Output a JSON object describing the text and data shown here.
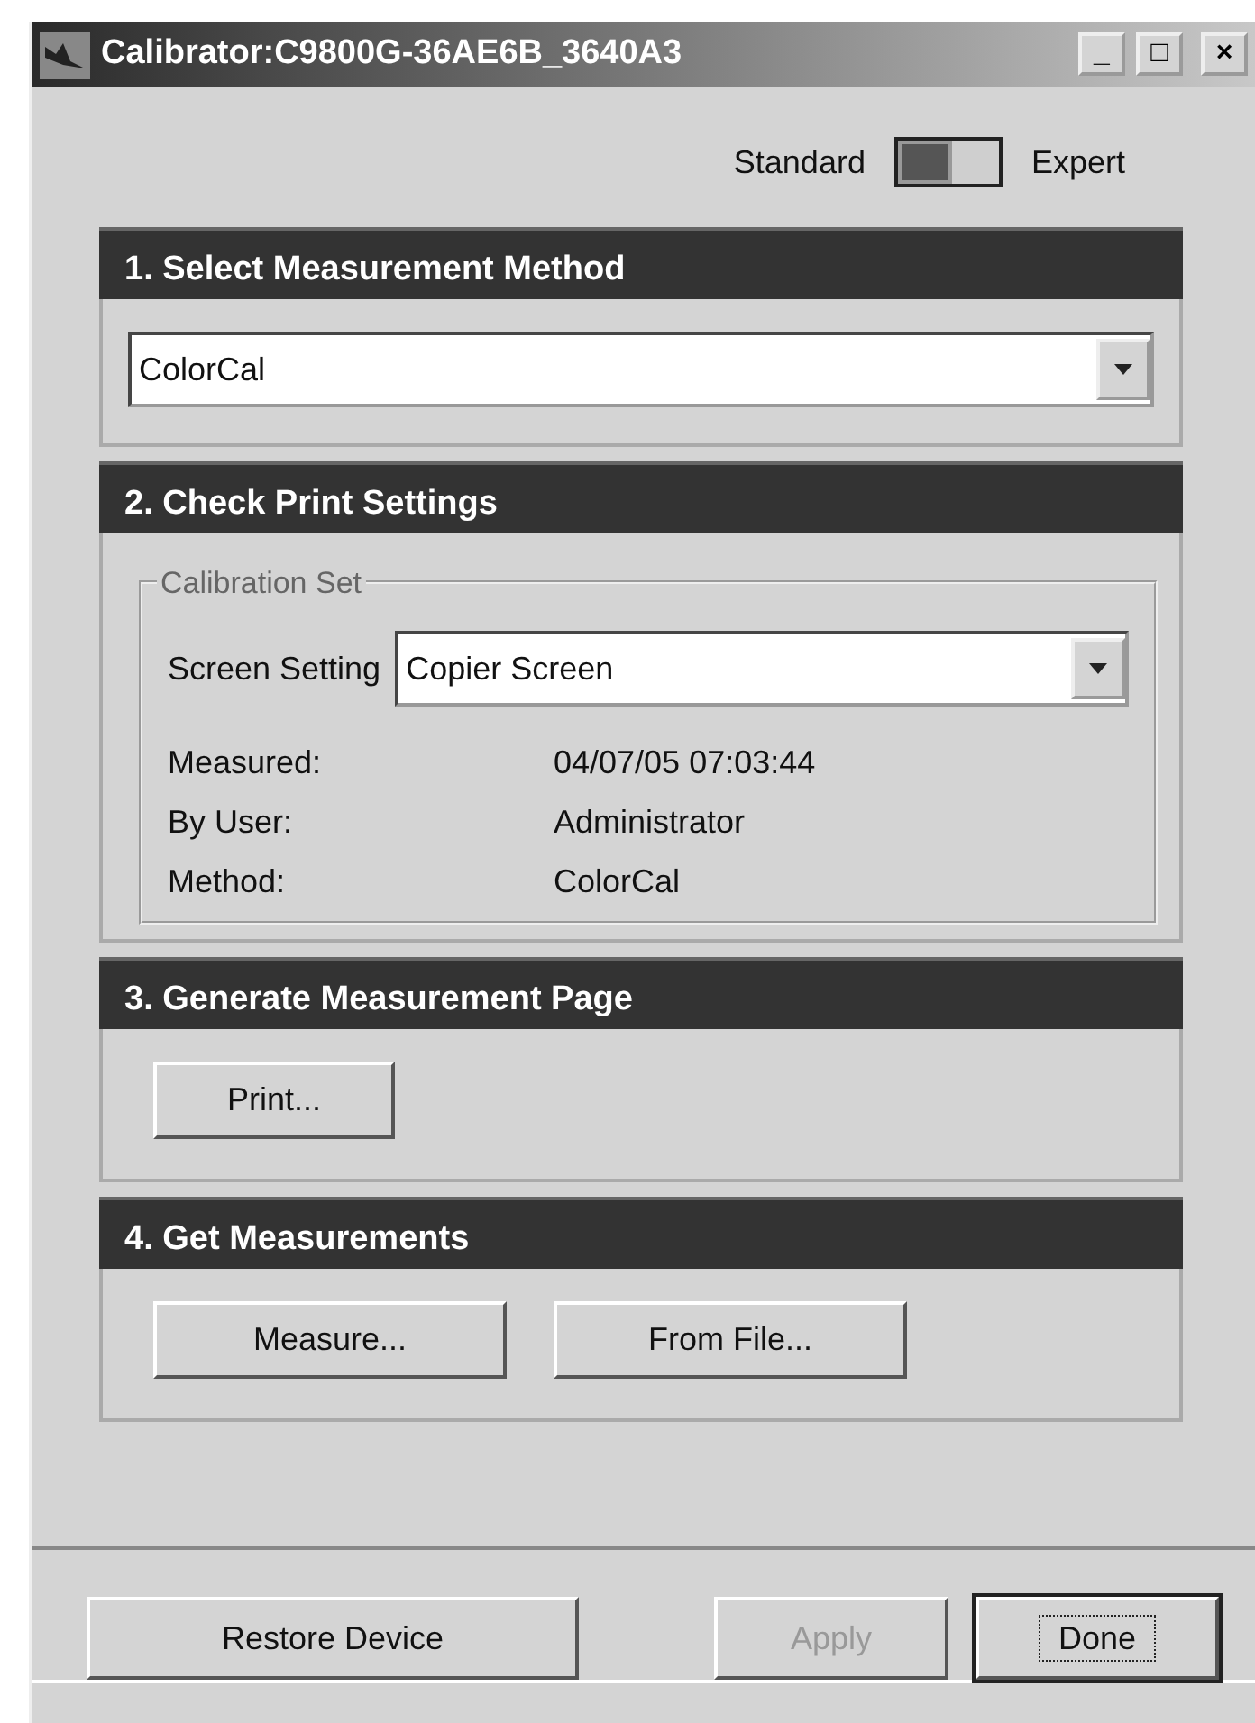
{
  "window": {
    "title": "Calibrator:C9800G-36AE6B_3640A3",
    "controls": [
      "_",
      "□",
      "×"
    ]
  },
  "mode_switch": {
    "left_label": "Standard",
    "right_label": "Expert",
    "on": false
  },
  "sections": [
    {
      "title": "1. Select Measurement Method",
      "kind": "dropdown",
      "value": "ColorCal"
    },
    {
      "title": "2. Check Print Settings",
      "kind": "settings",
      "group": {
        "legend": "Calibration Set",
        "field_label": "Screen Setting",
        "value": "Copier Screen",
        "rows": [
          {
            "label": "Measured:",
            "value": "04/07/05 07:03:44"
          },
          {
            "label": "By User:",
            "value": "Administrator"
          },
          {
            "label": "Method:",
            "value": "ColorCal"
          }
        ]
      }
    },
    {
      "title": "3. Generate Measurement Page",
      "kind": "buttons",
      "buttons": [
        "Print..."
      ]
    },
    {
      "title": "4. Get Measurements",
      "kind": "buttons",
      "buttons": [
        "Measure...",
        "From File..."
      ]
    }
  ],
  "footer_buttons": [
    {
      "label": "Restore Device",
      "disabled": false,
      "default": false
    },
    {
      "label": "Apply",
      "disabled": true,
      "default": false
    },
    {
      "label": "Done",
      "disabled": false,
      "default": true
    }
  ]
}
